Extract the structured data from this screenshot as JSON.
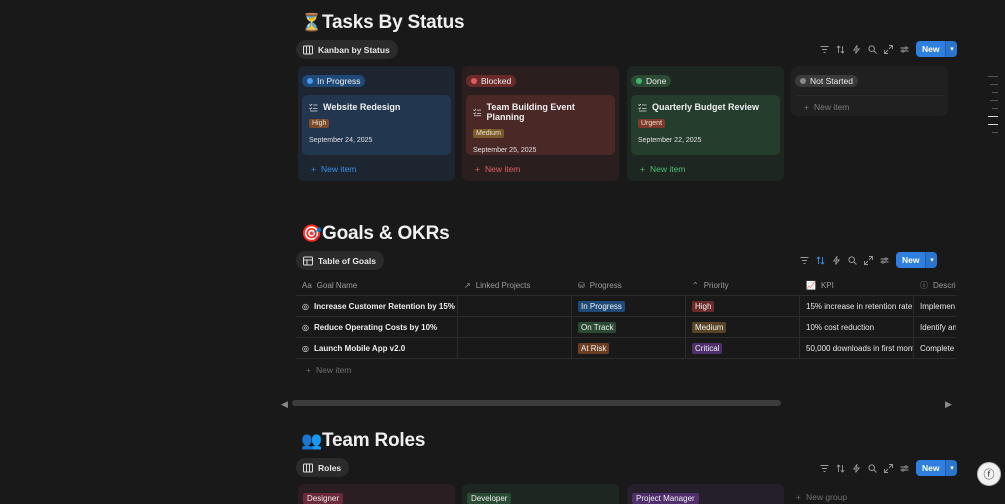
{
  "tasks": {
    "emoji": "⏳",
    "title": "Tasks By Status",
    "view_label": "Kanban by Status",
    "new_label": "New",
    "columns": [
      {
        "status": "In Progress",
        "dot": "#2f7fe0",
        "pill_bg": "#1f4a78",
        "card": {
          "title": "Website Redesign",
          "tag": "High",
          "tag_bg": "#7b4a2b",
          "date": "September 24, 2025"
        },
        "new_item": "New item",
        "new_color": "#3a8ee6"
      },
      {
        "status": "Blocked",
        "dot": "#e05a5a",
        "pill_bg": "#6b2a2a",
        "card": {
          "title": "Team Building Event Planning",
          "tag": "Medium",
          "tag_bg": "#7a5a2a",
          "date": "September 25, 2025"
        },
        "new_item": "New item",
        "new_color": "#e06060"
      },
      {
        "status": "Done",
        "dot": "#45b36b",
        "pill_bg": "#2a4a33",
        "card": {
          "title": "Quarterly Budget Review",
          "tag": "Urgent",
          "tag_bg": "#7b3a2b",
          "date": "September 22, 2025"
        },
        "new_item": "New item",
        "new_color": "#4bbf73"
      },
      {
        "status": "Not Started",
        "dot": "#8a8a8a",
        "pill_bg": "#3a3a3a",
        "new_item": "New item",
        "new_color": "#8a8a8a"
      }
    ]
  },
  "goals": {
    "emoji": "🎯",
    "title": "Goals & OKRs",
    "view_label": "Table of Goals",
    "new_label": "New",
    "headers": [
      "Goal Name",
      "Linked Projects",
      "Progress",
      "Priority",
      "KPI",
      "Descri"
    ],
    "rows": [
      {
        "name": "Increase Customer Retention by 15%",
        "progress": "In Progress",
        "progress_bg": "#1f4a78",
        "priority": "High",
        "priority_bg": "#6b2a2a",
        "kpi": "15% increase in retention rate",
        "desc": "Implemen"
      },
      {
        "name": "Reduce Operating Costs by 10%",
        "progress": "On Track",
        "progress_bg": "#2a4a33",
        "priority": "Medium",
        "priority_bg": "#5a4426",
        "kpi": "10% cost reduction",
        "desc": "Identify an"
      },
      {
        "name": "Launch Mobile App v2.0",
        "progress": "At Risk",
        "progress_bg": "#6b3f22",
        "priority": "Critical",
        "priority_bg": "#4f2e6b",
        "kpi": "50,000 downloads in first montl",
        "desc": "Complete c"
      }
    ],
    "new_item": "New item"
  },
  "roles": {
    "emoji": "👥",
    "title": "Team Roles",
    "view_label": "Roles",
    "new_label": "New",
    "groups": [
      {
        "label": "Designer",
        "bg": "#6b2a3a",
        "col_bg": "#2a1e22"
      },
      {
        "label": "Developer",
        "bg": "#2a4a33",
        "col_bg": "#1d2620"
      },
      {
        "label": "Project Manager",
        "bg": "#4f2e6b",
        "col_bg": "#241f2a"
      }
    ],
    "new_group": "New group"
  },
  "colors": {
    "accent": "#2f7fe0",
    "background": "#191919"
  }
}
